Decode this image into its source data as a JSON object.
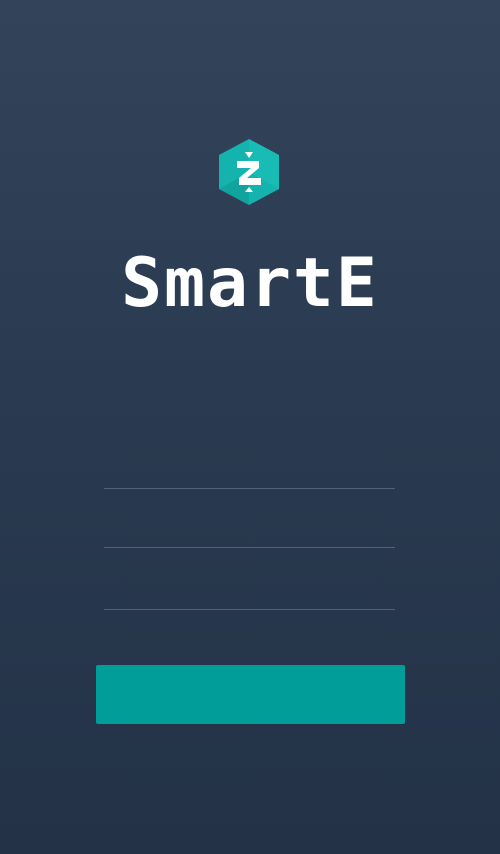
{
  "app": {
    "brand_name": "SmartE",
    "logo_icon": "hexagon-z-logo-icon",
    "accent_color": "#019d98",
    "logo_color": "#16b7b1"
  },
  "form": {
    "field_1": {
      "value": "",
      "placeholder": ""
    },
    "field_2": {
      "value": "",
      "placeholder": ""
    },
    "field_3": {
      "value": "",
      "placeholder": ""
    },
    "submit_label": ""
  },
  "footer": {
    "text": ""
  }
}
